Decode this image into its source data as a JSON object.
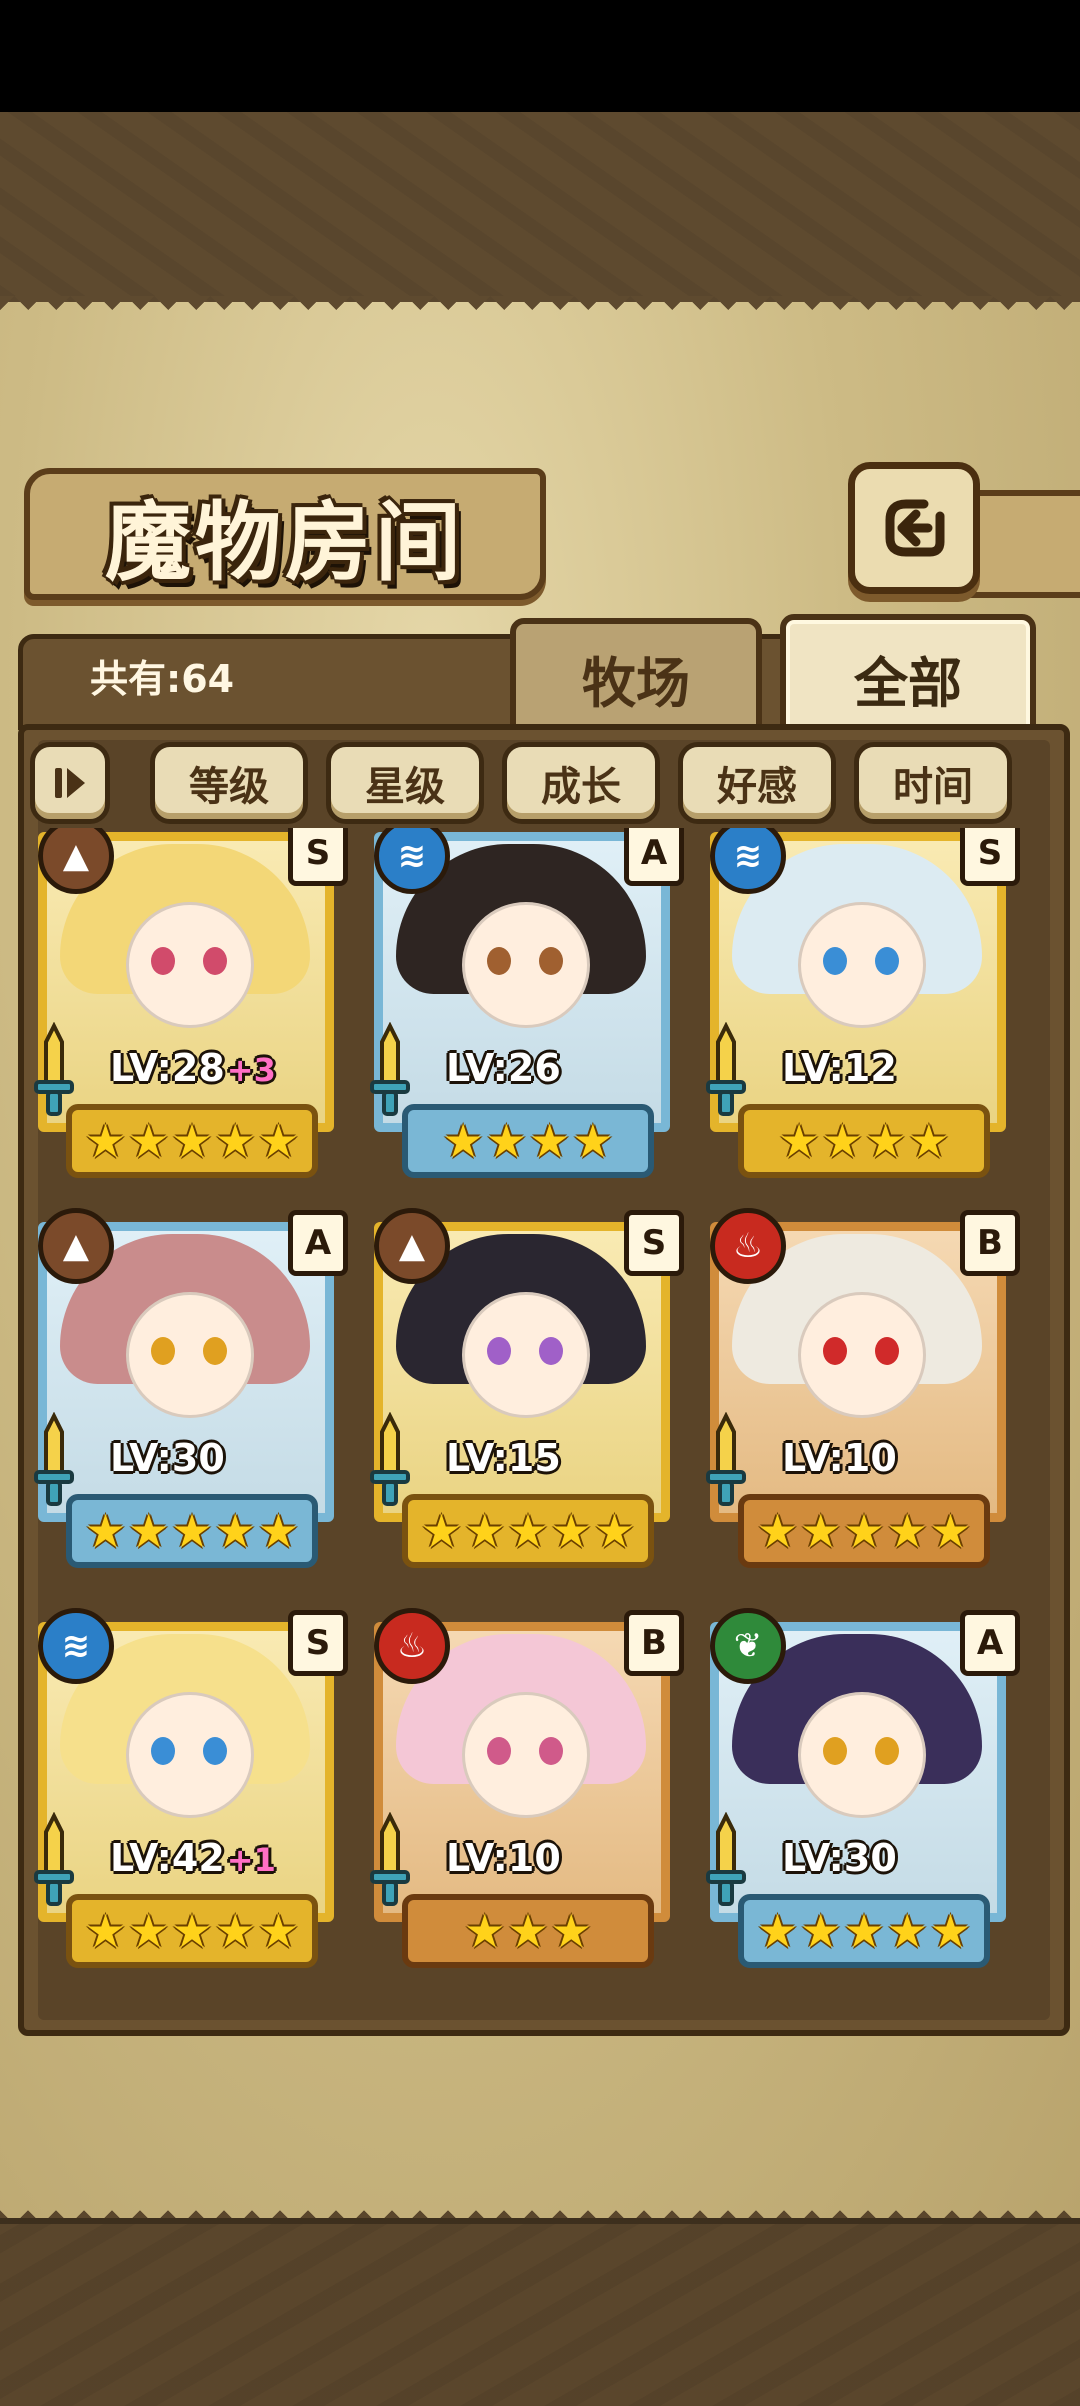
{
  "header": {
    "title": "魔物房间",
    "back_icon": "return-arrow-icon"
  },
  "tabs": {
    "count_label": "共有:64",
    "farm_label": "牧场",
    "all_label": "全部"
  },
  "sort": {
    "toggle_icon": "sort-direction-icon",
    "buttons": [
      "等级",
      "星级",
      "成长",
      "好感",
      "时间"
    ]
  },
  "colors": {
    "gold_frame": "#e4b42b",
    "blue_frame": "#79b7d6",
    "bronze_frame": "#d08c3b",
    "star": "#ffd21a",
    "plus_text": "#ff6fc5"
  },
  "monsters": [
    {
      "element": "earth",
      "rank": "S",
      "level": "LV:28",
      "bonus": "+3",
      "stars": 5,
      "frame": "gold",
      "hair": "#f3d777",
      "eyes": "#d14b6b"
    },
    {
      "element": "water",
      "rank": "A",
      "level": "LV:26",
      "bonus": "",
      "stars": 4,
      "frame": "blue",
      "hair": "#2e2522",
      "eyes": "#a06030"
    },
    {
      "element": "water",
      "rank": "S",
      "level": "LV:12",
      "bonus": "",
      "stars": 4,
      "frame": "gold",
      "hair": "#dcebf2",
      "eyes": "#3a8ed6"
    },
    {
      "element": "earth",
      "rank": "A",
      "level": "LV:30",
      "bonus": "",
      "stars": 5,
      "frame": "blue",
      "hair": "#c98c8c",
      "eyes": "#e0a020"
    },
    {
      "element": "earth",
      "rank": "S",
      "level": "LV:15",
      "bonus": "",
      "stars": 5,
      "frame": "gold",
      "hair": "#2a2630",
      "eyes": "#a060c8"
    },
    {
      "element": "fire",
      "rank": "B",
      "level": "LV:10",
      "bonus": "",
      "stars": 5,
      "frame": "bronze",
      "hair": "#eeeae0",
      "eyes": "#d02a2a"
    },
    {
      "element": "water",
      "rank": "S",
      "level": "LV:42",
      "bonus": "+1",
      "stars": 5,
      "frame": "gold",
      "hair": "#f6e08c",
      "eyes": "#3a8ed6"
    },
    {
      "element": "fire",
      "rank": "B",
      "level": "LV:10",
      "bonus": "",
      "stars": 3,
      "frame": "bronze",
      "hair": "#f4c7d6",
      "eyes": "#d05a8a"
    },
    {
      "element": "wood",
      "rank": "A",
      "level": "LV:30",
      "bonus": "",
      "stars": 5,
      "frame": "blue",
      "hair": "#3a2f5a",
      "eyes": "#e0a020"
    }
  ]
}
